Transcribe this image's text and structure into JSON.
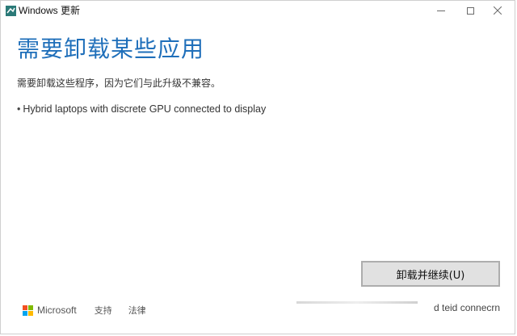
{
  "window": {
    "title": "Windows 更新"
  },
  "main": {
    "heading": "需要卸载某些应用",
    "description": "需要卸载这些程序，因为它们与此升级不兼容。",
    "apps": [
      "Hybrid laptops with discrete GPU connected to display"
    ]
  },
  "actions": {
    "primary_label": "卸载并继续(U)"
  },
  "footer": {
    "brand": "Microsoft",
    "support_label": "支持",
    "legal_label": "法律"
  },
  "overlay": {
    "fragment_text": "d teid connecrn"
  },
  "colors": {
    "heading": "#1f6fba",
    "button_bg": "#e1e1e1"
  }
}
